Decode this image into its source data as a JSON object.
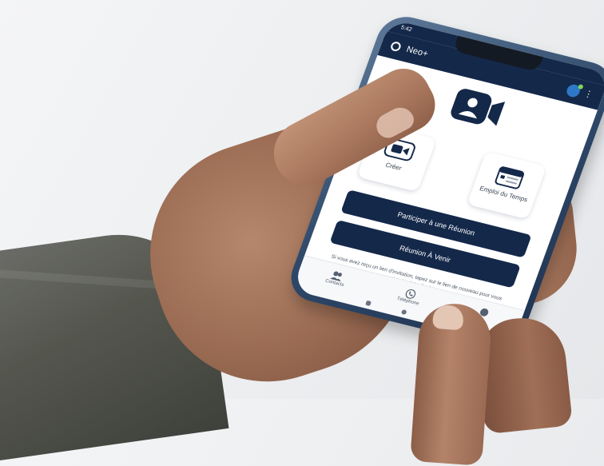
{
  "app": {
    "status_time": "5:42",
    "title": "Neo+"
  },
  "main": {
    "hero_icon": "video-user-icon",
    "tiles": [
      {
        "label": "Créer",
        "icon": "video-camera-icon"
      },
      {
        "label": "Emploi du Temps",
        "icon": "calendar-icon"
      }
    ],
    "buttons": {
      "join": "Participer à une Réunion",
      "upcoming": "Réunion À Venir"
    },
    "hint": "Si vous avez reçu un lien d'invitation, tapez sur le lien de nouveau pour vous joindre à la réunion"
  },
  "bottom_nav": {
    "items": [
      {
        "label": "Contacts",
        "icon": "contacts-icon"
      },
      {
        "label": "Téléphone",
        "icon": "phone-icon"
      },
      {
        "label": "",
        "icon": "more-icon"
      }
    ]
  },
  "colors": {
    "brand": "#14284a",
    "background": "#eceef0"
  }
}
